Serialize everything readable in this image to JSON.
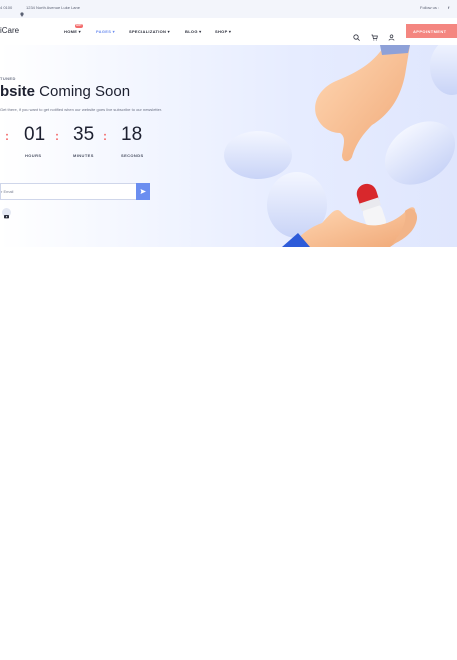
{
  "topbar": {
    "phone": "4 0100",
    "address": "1234 North Avenue Luke Lane",
    "follow": "Follow us :"
  },
  "header": {
    "logo": "iCare",
    "nav": [
      {
        "label": "HOME ▾",
        "badge": "HOT"
      },
      {
        "label": "PAGES ▾"
      },
      {
        "label": "SPECIALIZATION ▾"
      },
      {
        "label": "BLOG ▾"
      },
      {
        "label": "SHOP ▾"
      }
    ],
    "appointment_label": "APPOINTMENT"
  },
  "hero": {
    "kicker": "TUNED",
    "title_bold": "bsite",
    "title_rest": " Coming Soon",
    "description": "Get there, if you want to get notified when our website goes live subscribe to our newsletter.",
    "countdown": [
      {
        "value": "01",
        "label": "HOURS"
      },
      {
        "value": "35",
        "label": "MINUTES"
      },
      {
        "value": "18",
        "label": "SECONDS"
      }
    ],
    "email_placeholder": "r Email"
  },
  "colors": {
    "accent": "#6b8ef0",
    "appointment": "#f48680",
    "separator": "#f36b6b"
  },
  "icons": [
    "location-icon",
    "facebook-icon",
    "search-icon",
    "cart-icon",
    "user-icon",
    "send-icon",
    "youtube-icon"
  ]
}
